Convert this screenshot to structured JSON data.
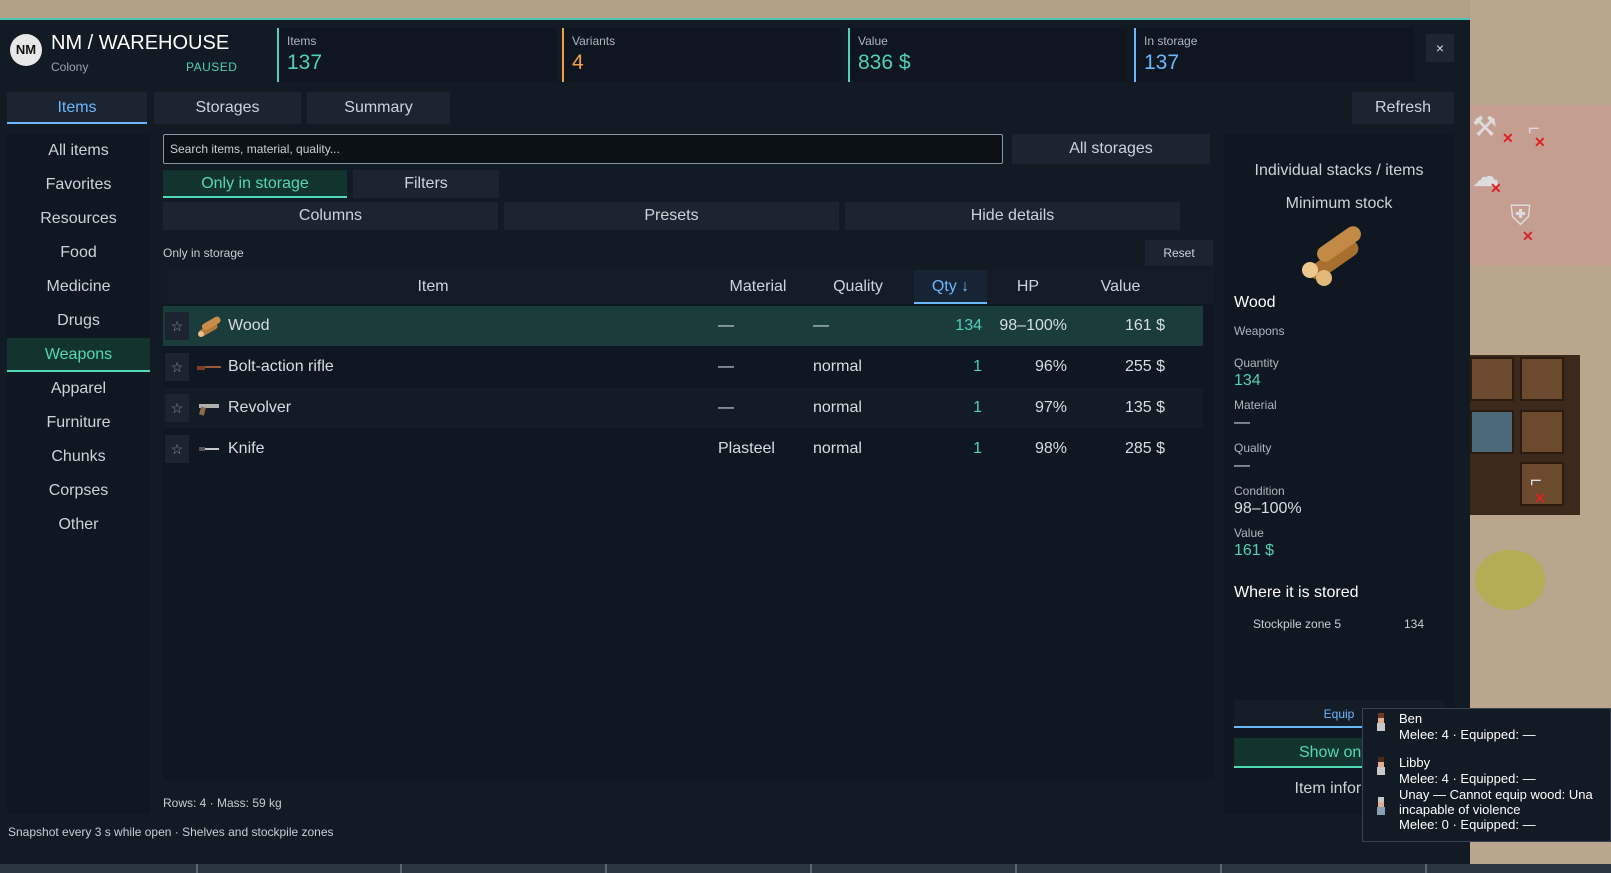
{
  "colony": {
    "title": "NM / WAREHOUSE",
    "subtitle": "Colony",
    "status": "PAUSED",
    "logo": "NM"
  },
  "stats": [
    {
      "label": "Items",
      "value": "137",
      "color": "#4fd1b8"
    },
    {
      "label": "Variants",
      "value": "4",
      "color": "#f0a046"
    },
    {
      "label": "Value",
      "value": "836 $",
      "color": "#4fd1b8"
    },
    {
      "label": "In storage",
      "value": "137",
      "color": "#6ab8ff"
    }
  ],
  "close_label": "×",
  "tabs": [
    "Items",
    "Storages",
    "Summary"
  ],
  "refresh_label": "Refresh",
  "categories": [
    "All items",
    "Favorites",
    "Resources",
    "Food",
    "Medicine",
    "Drugs",
    "Weapons",
    "Apparel",
    "Furniture",
    "Chunks",
    "Corpses",
    "Other"
  ],
  "search": {
    "placeholder": "Search items, material, quality..."
  },
  "storage_select": "All storages",
  "toggle_only_in_storage": "Only in storage",
  "filters_label": "Filters",
  "columns_label": "Columns",
  "presets_label": "Presets",
  "hide_details_label": "Hide details",
  "active_filter_label": "Only in storage",
  "reset_label": "Reset",
  "table": {
    "headers": {
      "item": "Item",
      "material": "Material",
      "quality": "Quality",
      "qty": "Qty ↓",
      "hp": "HP",
      "value": "Value"
    },
    "star": "☆",
    "rows": [
      {
        "name": "Wood",
        "material": "—",
        "quality": "—",
        "qty": "134",
        "hp": "98–100%",
        "value": "161 $",
        "icon": "wood-icon"
      },
      {
        "name": "Bolt-action rifle",
        "material": "—",
        "quality": "normal",
        "qty": "1",
        "hp": "96%",
        "value": "255 $",
        "icon": "rifle-icon"
      },
      {
        "name": "Revolver",
        "material": "—",
        "quality": "normal",
        "qty": "1",
        "hp": "97%",
        "value": "135 $",
        "icon": "revolver-icon"
      },
      {
        "name": "Knife",
        "material": "Plasteel",
        "quality": "normal",
        "qty": "1",
        "hp": "98%",
        "value": "285 $",
        "icon": "knife-icon"
      }
    ]
  },
  "footer": {
    "rows_info": "Rows: 4 · Mass: 59 kg",
    "snapshot_info": "Snapshot every 3 s while open · Shelves and stockpile zones"
  },
  "detail": {
    "mode_label": "Individual stacks / items",
    "min_stock_label": "Minimum stock",
    "name": "Wood",
    "category": "Weapons",
    "quantity_label": "Quantity",
    "quantity": "134",
    "material_label": "Material",
    "material": "—",
    "quality_label": "Quality",
    "quality": "—",
    "condition_label": "Condition",
    "condition": "98–100%",
    "value_label": "Value",
    "value": "161 $",
    "where_label": "Where it is stored",
    "locations": [
      {
        "zone": "Stockpile zone 5",
        "qty": "134"
      }
    ],
    "equip_label": "Equip",
    "show_on_map_label": "Show on m",
    "item_info_label": "Item informa"
  },
  "equip_popup": [
    {
      "name": "Ben",
      "stats": "Melee: 4 · Equipped: —"
    },
    {
      "name": "Libby",
      "stats": "Melee: 4 · Equipped: —"
    },
    {
      "name": "Unay — Cannot equip wood: Una",
      "stats": "incapable of violence",
      "extra": "Melee: 0 · Equipped: —"
    }
  ]
}
